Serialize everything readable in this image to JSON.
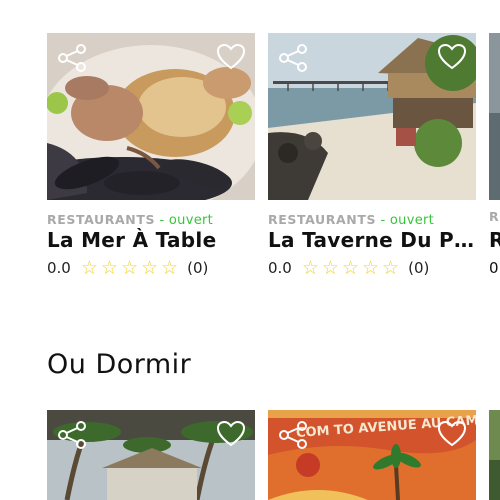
{
  "restaurants": [
    {
      "category": "RESTAURANTS",
      "status": " - ouvert",
      "name": "La Mer À Table",
      "rating": "0.0",
      "review_count": "(0)"
    },
    {
      "category": "RESTAURANTS",
      "status": " - ouvert",
      "name": "La Taverne Du Pêc...",
      "rating": "0.0",
      "review_count": "(0)"
    },
    {
      "category": "R",
      "name": "R",
      "rating": "0"
    }
  ],
  "sections": {
    "lodging_title": "Ou Dormir"
  },
  "lodging": [
    {
      "sign_text": "COM TO AVENUE AU CAMP"
    }
  ],
  "colors": {
    "open_status": "#37c53a",
    "category": "#a9a9a9",
    "star": "#f3d12e"
  },
  "icons": {
    "share": "share-icon",
    "favorite": "heart-icon",
    "star": "star-outline-icon"
  }
}
